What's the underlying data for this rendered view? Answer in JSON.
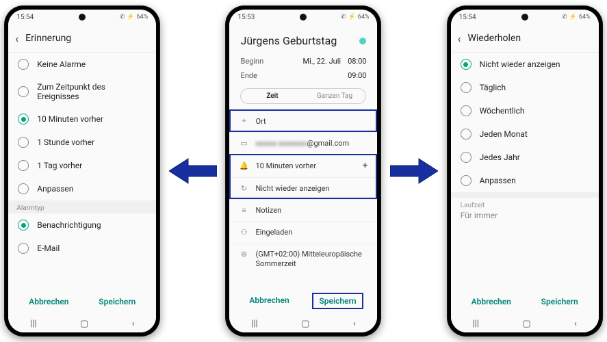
{
  "statusbar": {
    "time_left": "15:54",
    "time_mid": "15:53",
    "time_right": "15:54",
    "battery": "64%"
  },
  "left": {
    "header": "Erinnerung",
    "options": [
      "Keine Alarme",
      "Zum Zeitpunkt des Ereignisses",
      "10 Minuten vorher",
      "1 Stunde vorher",
      "1 Tag vorher",
      "Anpassen"
    ],
    "selected_index": 2,
    "section": "Alarmtyp",
    "alarm_types": [
      "Benachrichtigung",
      "E-Mail"
    ],
    "alarm_selected_index": 0
  },
  "middle": {
    "title": "Jürgens Geburtstag",
    "start_label": "Beginn",
    "start_date": "Mi., 22. Juli",
    "start_time": "08:00",
    "end_label": "Ende",
    "end_time": "09:00",
    "seg_time": "Zeit",
    "seg_allday": "Ganzen Tag",
    "location": "Ort",
    "account_suffix": "@gmail.com",
    "reminder": "10 Minuten vorher",
    "repeat": "Nicht wieder anzeigen",
    "notes": "Notizen",
    "invited": "Eingeladen",
    "timezone": "(GMT+02:00) Mitteleuropäische Sommerzeit"
  },
  "right": {
    "header": "Wiederholen",
    "options": [
      "Nicht wieder anzeigen",
      "Täglich",
      "Wöchentlich",
      "Jeden Monat",
      "Jedes Jahr",
      "Anpassen"
    ],
    "selected_index": 0,
    "duration_label": "Laufzeit",
    "duration_value": "Für immer"
  },
  "buttons": {
    "cancel": "Abbrechen",
    "save": "Speichern"
  }
}
